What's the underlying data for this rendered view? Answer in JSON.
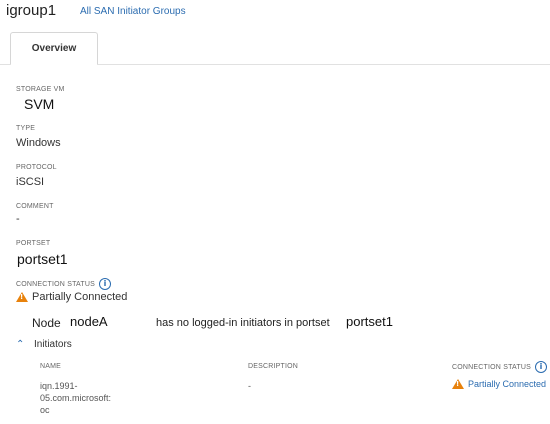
{
  "header": {
    "title": "igroup1",
    "breadcrumb": "All SAN Initiator Groups"
  },
  "tabs": [
    {
      "label": "Overview"
    }
  ],
  "fields": {
    "storage_vm_label": "STORAGE VM",
    "storage_vm_value": "SVM",
    "type_label": "TYPE",
    "type_value": "Windows",
    "protocol_label": "PROTOCOL",
    "protocol_value": "iSCSI",
    "comment_label": "COMMENT",
    "comment_value": "-",
    "portset_label": "PORTSET",
    "portset_value": "portset1",
    "connection_status_label": "CONNECTION STATUS",
    "connection_status_value": "Partially Connected"
  },
  "message": {
    "node_label": "Node",
    "node_value": "nodeA",
    "text": "has no logged-in initiators in portset",
    "portset_value": "portset1"
  },
  "initiators": {
    "section_label": "Initiators",
    "columns": {
      "name": "NAME",
      "description": "DESCRIPTION",
      "connection_status": "CONNECTION STATUS"
    },
    "rows": [
      {
        "name_lines": [
          "iqn.1991-",
          "05.com.microsoft:",
          "oc"
        ],
        "description": "-",
        "connection_status": "Partially Connected"
      }
    ]
  },
  "icons": {
    "info": "info-icon",
    "warning": "warning-icon",
    "chevron": "chevron-up-icon"
  },
  "colors": {
    "link": "#2b6cb0",
    "warning": "#e8820c"
  }
}
